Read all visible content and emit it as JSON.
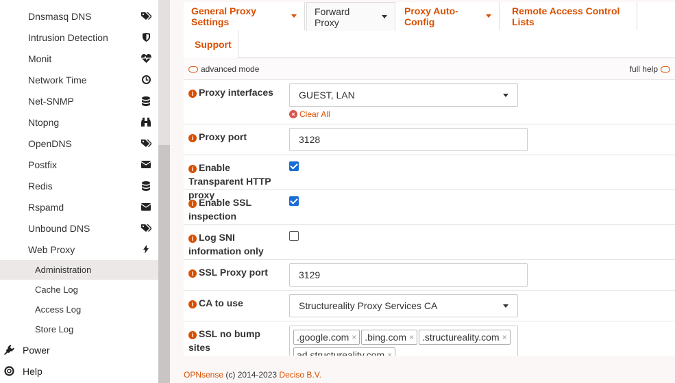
{
  "sidebar": {
    "items": [
      {
        "label": "Dnsmasq DNS",
        "icon": "tags-icon"
      },
      {
        "label": "Intrusion Detection",
        "icon": "shield-icon"
      },
      {
        "label": "Monit",
        "icon": "heartbeat-icon"
      },
      {
        "label": "Network Time",
        "icon": "clock-icon"
      },
      {
        "label": "Net-SNMP",
        "icon": "database-icon"
      },
      {
        "label": "Ntopng",
        "icon": "binoculars-icon"
      },
      {
        "label": "OpenDNS",
        "icon": "tags-icon"
      },
      {
        "label": "Postfix",
        "icon": "envelope-icon"
      },
      {
        "label": "Redis",
        "icon": "database-icon"
      },
      {
        "label": "Rspamd",
        "icon": "envelope-icon"
      },
      {
        "label": "Unbound DNS",
        "icon": "tags-icon"
      },
      {
        "label": "Web Proxy",
        "icon": "bolt-icon"
      }
    ],
    "sub_items": [
      {
        "label": "Administration",
        "active": true
      },
      {
        "label": "Cache Log"
      },
      {
        "label": "Access Log"
      },
      {
        "label": "Store Log"
      }
    ],
    "top_items": [
      {
        "label": "Power",
        "icon": "plug-icon"
      },
      {
        "label": "Help",
        "icon": "life-ring-icon"
      }
    ]
  },
  "tabs": [
    {
      "label": "General Proxy Settings",
      "dropdown": true
    },
    {
      "label": "Forward Proxy",
      "dropdown": true,
      "active": true
    },
    {
      "label": "Proxy Auto-Config",
      "dropdown": true
    },
    {
      "label": "Remote Access Control Lists",
      "dropdown": false
    },
    {
      "label": "Support",
      "dropdown": false
    }
  ],
  "mode": {
    "advanced": "advanced mode",
    "help": "full help"
  },
  "form": {
    "proxy_interfaces": {
      "label": "Proxy interfaces",
      "value": "GUEST, LAN",
      "clear": "Clear All"
    },
    "proxy_port": {
      "label": "Proxy port",
      "value": "3128"
    },
    "transparent": {
      "label": "Enable Transparent HTTP proxy",
      "checked": true
    },
    "ssl_inspection": {
      "label": "Enable SSL inspection",
      "checked": true
    },
    "log_sni": {
      "label": "Log SNI information only",
      "checked": false
    },
    "ssl_port": {
      "label": "SSL Proxy port",
      "value": "3129"
    },
    "ca": {
      "label": "CA to use",
      "value": "Structureality Proxy Services CA"
    },
    "no_bump": {
      "label": "SSL no bump sites",
      "tags": [
        ".google.com",
        ".bing.com",
        ".structureality.com",
        "ad.structureality.com"
      ]
    }
  },
  "footer": {
    "brand": "OPNsense",
    "copyright": " (c) 2014-2023 ",
    "company": "Deciso B.V."
  },
  "colors": {
    "accent": "#d94f00",
    "checkbox": "#1a6dd6"
  }
}
